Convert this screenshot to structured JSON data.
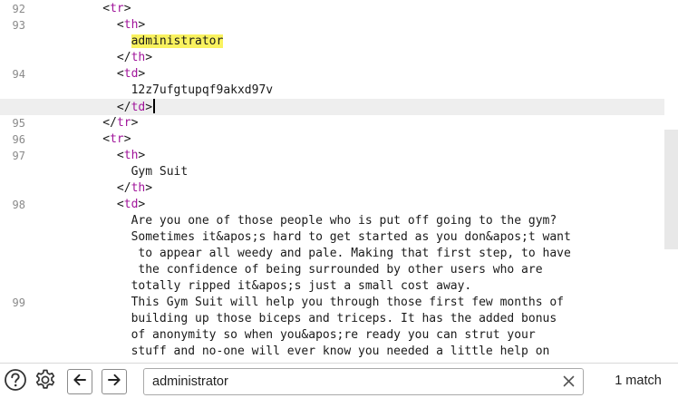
{
  "editor": {
    "lines": [
      {
        "gutter": "92",
        "indent": "          ",
        "segments": [
          {
            "k": "plain",
            "t": "<"
          },
          {
            "k": "tag",
            "t": "tr"
          },
          {
            "k": "plain",
            "t": ">"
          }
        ]
      },
      {
        "gutter": "93",
        "indent": "            ",
        "segments": [
          {
            "k": "plain",
            "t": "<"
          },
          {
            "k": "tag",
            "t": "th"
          },
          {
            "k": "plain",
            "t": ">"
          }
        ]
      },
      {
        "gutter": "",
        "indent": "              ",
        "segments": [
          {
            "k": "hl",
            "t": "administrator"
          }
        ]
      },
      {
        "gutter": "",
        "indent": "            ",
        "segments": [
          {
            "k": "plain",
            "t": "</"
          },
          {
            "k": "tag",
            "t": "th"
          },
          {
            "k": "plain",
            "t": ">"
          }
        ]
      },
      {
        "gutter": "94",
        "indent": "            ",
        "segments": [
          {
            "k": "plain",
            "t": "<"
          },
          {
            "k": "tag",
            "t": "td"
          },
          {
            "k": "plain",
            "t": ">"
          }
        ]
      },
      {
        "gutter": "",
        "indent": "              ",
        "segments": [
          {
            "k": "plain",
            "t": "12z7ufgtupqf9akxd97v"
          }
        ]
      },
      {
        "gutter": "",
        "indent": "            ",
        "current": true,
        "segments": [
          {
            "k": "plain",
            "t": "</"
          },
          {
            "k": "tag",
            "t": "td"
          },
          {
            "k": "plain",
            "t": ">"
          },
          {
            "k": "caret",
            "t": ""
          }
        ]
      },
      {
        "gutter": "95",
        "indent": "          ",
        "segments": [
          {
            "k": "plain",
            "t": "</"
          },
          {
            "k": "tag",
            "t": "tr"
          },
          {
            "k": "plain",
            "t": ">"
          }
        ]
      },
      {
        "gutter": "96",
        "indent": "          ",
        "segments": [
          {
            "k": "plain",
            "t": "<"
          },
          {
            "k": "tag",
            "t": "tr"
          },
          {
            "k": "plain",
            "t": ">"
          }
        ]
      },
      {
        "gutter": "97",
        "indent": "            ",
        "segments": [
          {
            "k": "plain",
            "t": "<"
          },
          {
            "k": "tag",
            "t": "th"
          },
          {
            "k": "plain",
            "t": ">"
          }
        ]
      },
      {
        "gutter": "",
        "indent": "              ",
        "segments": [
          {
            "k": "plain",
            "t": "Gym Suit"
          }
        ]
      },
      {
        "gutter": "",
        "indent": "            ",
        "segments": [
          {
            "k": "plain",
            "t": "</"
          },
          {
            "k": "tag",
            "t": "th"
          },
          {
            "k": "plain",
            "t": ">"
          }
        ]
      },
      {
        "gutter": "98",
        "indent": "            ",
        "segments": [
          {
            "k": "plain",
            "t": "<"
          },
          {
            "k": "tag",
            "t": "td"
          },
          {
            "k": "plain",
            "t": ">"
          }
        ]
      },
      {
        "gutter": "",
        "indent": "              ",
        "segments": [
          {
            "k": "plain",
            "t": "Are you one of those people who is put off going to the gym?"
          }
        ]
      },
      {
        "gutter": "",
        "indent": "              ",
        "segments": [
          {
            "k": "plain",
            "t": "Sometimes it&apos;s hard to get started as you don&apos;t want"
          }
        ]
      },
      {
        "gutter": "",
        "indent": "               ",
        "segments": [
          {
            "k": "plain",
            "t": "to appear all weedy and pale. Making that first step, to have"
          }
        ]
      },
      {
        "gutter": "",
        "indent": "               ",
        "segments": [
          {
            "k": "plain",
            "t": "the confidence of being surrounded by other users who are"
          }
        ]
      },
      {
        "gutter": "",
        "indent": "              ",
        "segments": [
          {
            "k": "plain",
            "t": "totally ripped it&apos;s just a small cost away."
          }
        ]
      },
      {
        "gutter": "99",
        "indent": "              ",
        "segments": [
          {
            "k": "plain",
            "t": "This Gym Suit will help you through those first few months of"
          }
        ]
      },
      {
        "gutter": "",
        "indent": "              ",
        "segments": [
          {
            "k": "plain",
            "t": "building up those biceps and triceps. It has the added bonus"
          }
        ]
      },
      {
        "gutter": "",
        "indent": "              ",
        "segments": [
          {
            "k": "plain",
            "t": "of anonymity so when you&apos;re ready you can strut your"
          }
        ]
      },
      {
        "gutter": "",
        "indent": "              ",
        "segments": [
          {
            "k": "plain",
            "t": "stuff and no-one will ever know you needed a little help on"
          }
        ]
      }
    ]
  },
  "findbar": {
    "help_icon": "help-circle-icon",
    "settings_icon": "gear-icon",
    "prev_icon": "arrow-left-icon",
    "next_icon": "arrow-right-icon",
    "clear_icon": "close-icon",
    "search_value": "administrator",
    "match_count": "1 match"
  },
  "colors": {
    "tag": "#a0149a",
    "highlight": "#f9f25f",
    "current_line": "#eeeeee"
  }
}
